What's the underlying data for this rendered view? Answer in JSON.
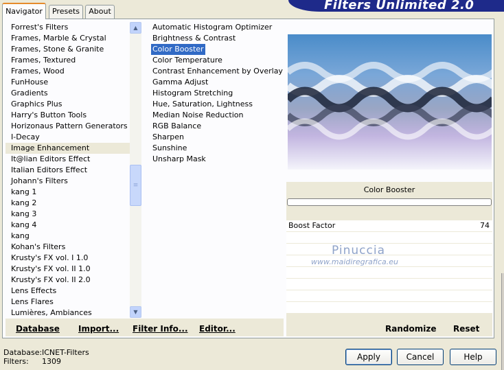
{
  "app": {
    "title": "Filters Unlimited 2.0"
  },
  "tabs": [
    {
      "label": "Navigator",
      "active": true
    },
    {
      "label": "Presets",
      "active": false
    },
    {
      "label": "About",
      "active": false
    }
  ],
  "categories": {
    "items": [
      "Forrest's Filters",
      "Frames, Marble & Crystal",
      "Frames, Stone & Granite",
      "Frames, Textured",
      "Frames, Wood",
      "FunHouse",
      "Gradients",
      "Graphics Plus",
      "Harry's Button Tools",
      "Horizonaus Pattern Generators",
      "I-Decay",
      "Image Enhancement",
      "It@lian Editors Effect",
      "Italian Editors Effect",
      "Johann's Filters",
      "kang 1",
      "kang 2",
      "kang 3",
      "kang 4",
      "kang",
      "Kohan's Filters",
      "Krusty's FX vol. I 1.0",
      "Krusty's FX vol. II 1.0",
      "Krusty's FX vol. II 2.0",
      "Lens Effects",
      "Lens Flares",
      "Lumières, Ambiances"
    ],
    "selected": "Image Enhancement"
  },
  "filters": {
    "items": [
      "Automatic Histogram Optimizer",
      "Brightness & Contrast",
      "Color Booster",
      "Color Temperature",
      "Contrast Enhancement by Overlay",
      "Gamma Adjust",
      "Histogram Stretching",
      "Hue, Saturation, Lightness",
      "Median Noise Reduction",
      "RGB Balance",
      "Sharpen",
      "Sunshine",
      "Unsharp Mask"
    ],
    "selected": "Color Booster"
  },
  "preview": {
    "filter_name": "Color Booster",
    "params": [
      {
        "label": "Boost Factor",
        "value": "74"
      }
    ],
    "watermark_name": "Pinuccia",
    "watermark_url": "www.maidiregrafica.eu"
  },
  "toolbar": {
    "database": "Database",
    "import": "Import...",
    "filter_info": "Filter Info...",
    "editor": "Editor...",
    "randomize": "Randomize",
    "reset": "Reset"
  },
  "status": {
    "database_label": "Database:",
    "database_value": "ICNET-Filters",
    "filters_label": "Filters:",
    "filters_value": "1309"
  },
  "buttons": {
    "apply": "Apply",
    "cancel": "Cancel",
    "help": "Help"
  },
  "colors": {
    "selection": "#316ac5",
    "banner": "#1e2a8a",
    "accent_tab": "#e68b2c"
  }
}
